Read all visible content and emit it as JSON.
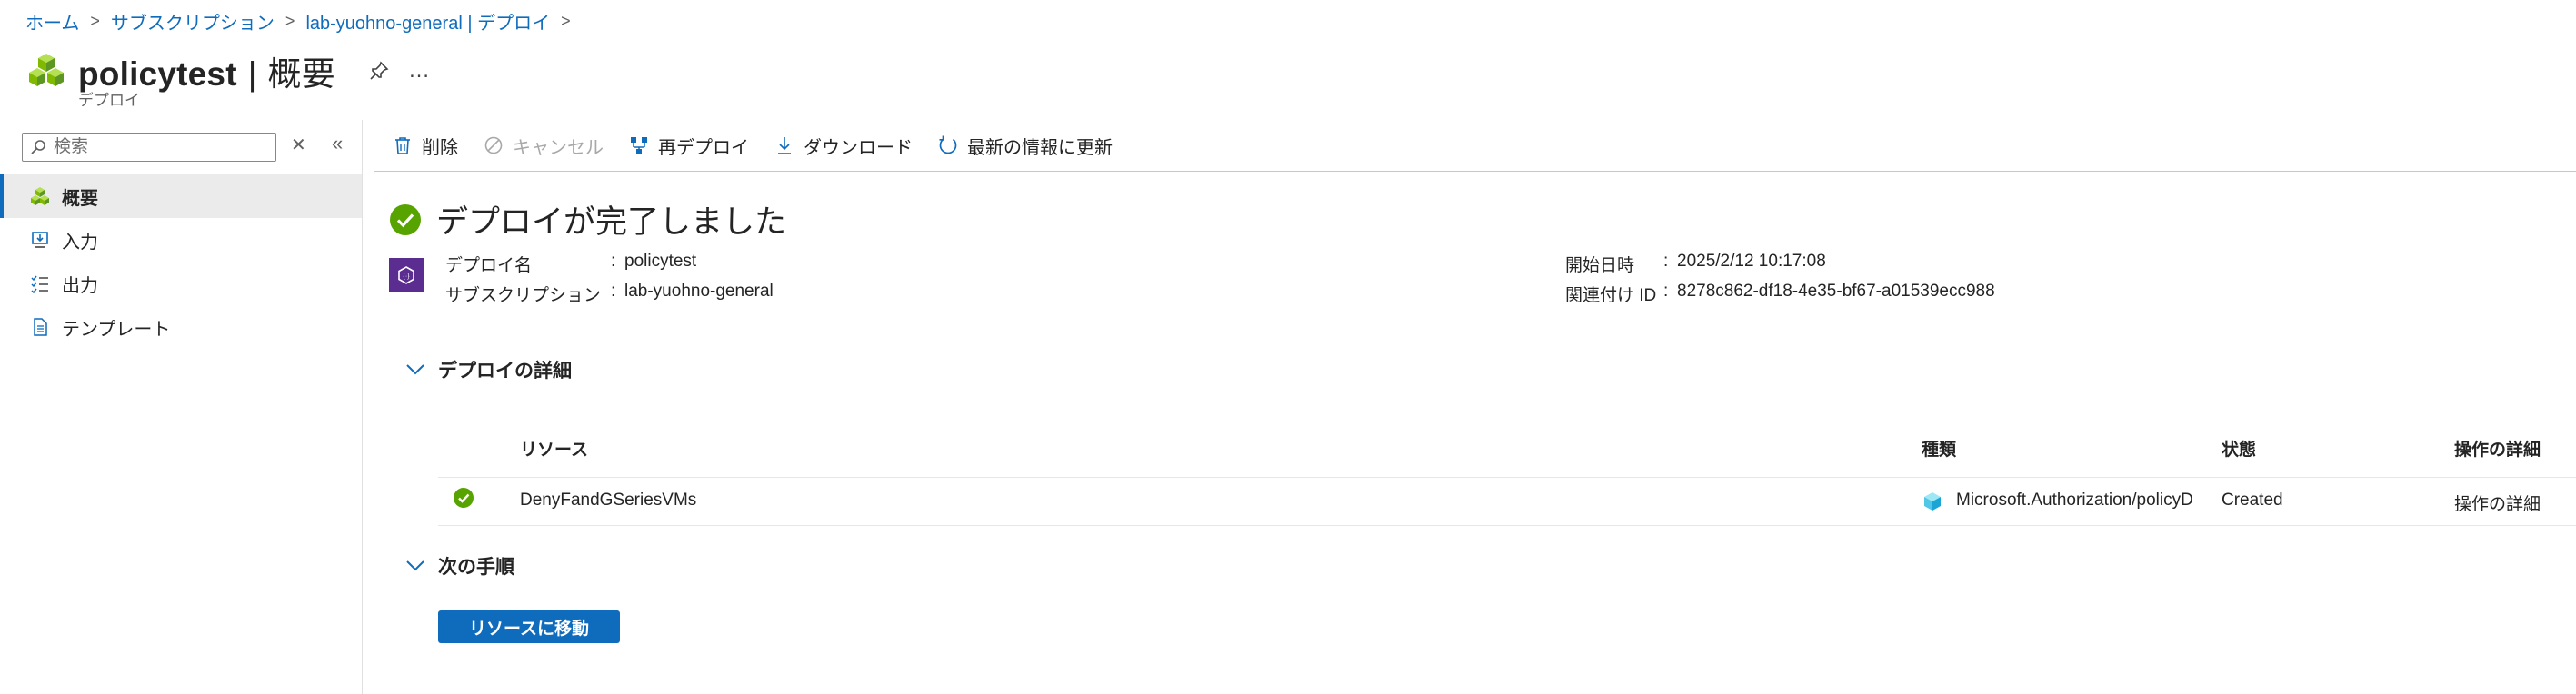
{
  "breadcrumb": {
    "home": "ホーム",
    "subscriptions": "サブスクリプション",
    "deployment": "lab-yuohno-general | デプロイ"
  },
  "header": {
    "title_main": "policytest",
    "title_separator": "|",
    "title_sub": "概要",
    "subtitle": "デプロイ",
    "more": "…"
  },
  "sidebar": {
    "search_placeholder": "検索",
    "items": [
      {
        "label": "概要",
        "icon": "overview-cubes-icon",
        "active": true
      },
      {
        "label": "入力",
        "icon": "input-icon",
        "active": false
      },
      {
        "label": "出力",
        "icon": "output-list-icon",
        "active": false
      },
      {
        "label": "テンプレート",
        "icon": "template-document-icon",
        "active": false
      }
    ]
  },
  "toolbar": {
    "delete": "削除",
    "cancel": "キャンセル",
    "redeploy": "再デプロイ",
    "download": "ダウンロード",
    "refresh": "最新の情報に更新"
  },
  "status": {
    "heading": "デプロイが完了しました",
    "deploy_name_label": "デプロイ名",
    "deploy_name_value": "policytest",
    "subscription_label": "サブスクリプション",
    "subscription_value": "lab-yuohno-general",
    "start_time_label": "開始日時",
    "start_time_value": "2025/2/12 10:17:08",
    "correlation_label": "関連付け ID",
    "correlation_value": "8278c862-df18-4e35-bf67-a01539ecc988",
    "colon": ":"
  },
  "details": {
    "heading": "デプロイの詳細",
    "columns": {
      "resource": "リソース",
      "type": "種類",
      "state": "状態",
      "operation": "操作の詳細"
    },
    "rows": [
      {
        "resource": "DenyFandGSeriesVMs",
        "type": "Microsoft.Authorization/policyD",
        "state": "Created",
        "operation": "操作の詳細"
      }
    ]
  },
  "next_steps": {
    "heading": "次の手順",
    "button": "リソースに移動"
  },
  "colors": {
    "accent": "#0f6cbd",
    "success": "#57a300",
    "deploy_icon_bg": "#5c2d91"
  }
}
